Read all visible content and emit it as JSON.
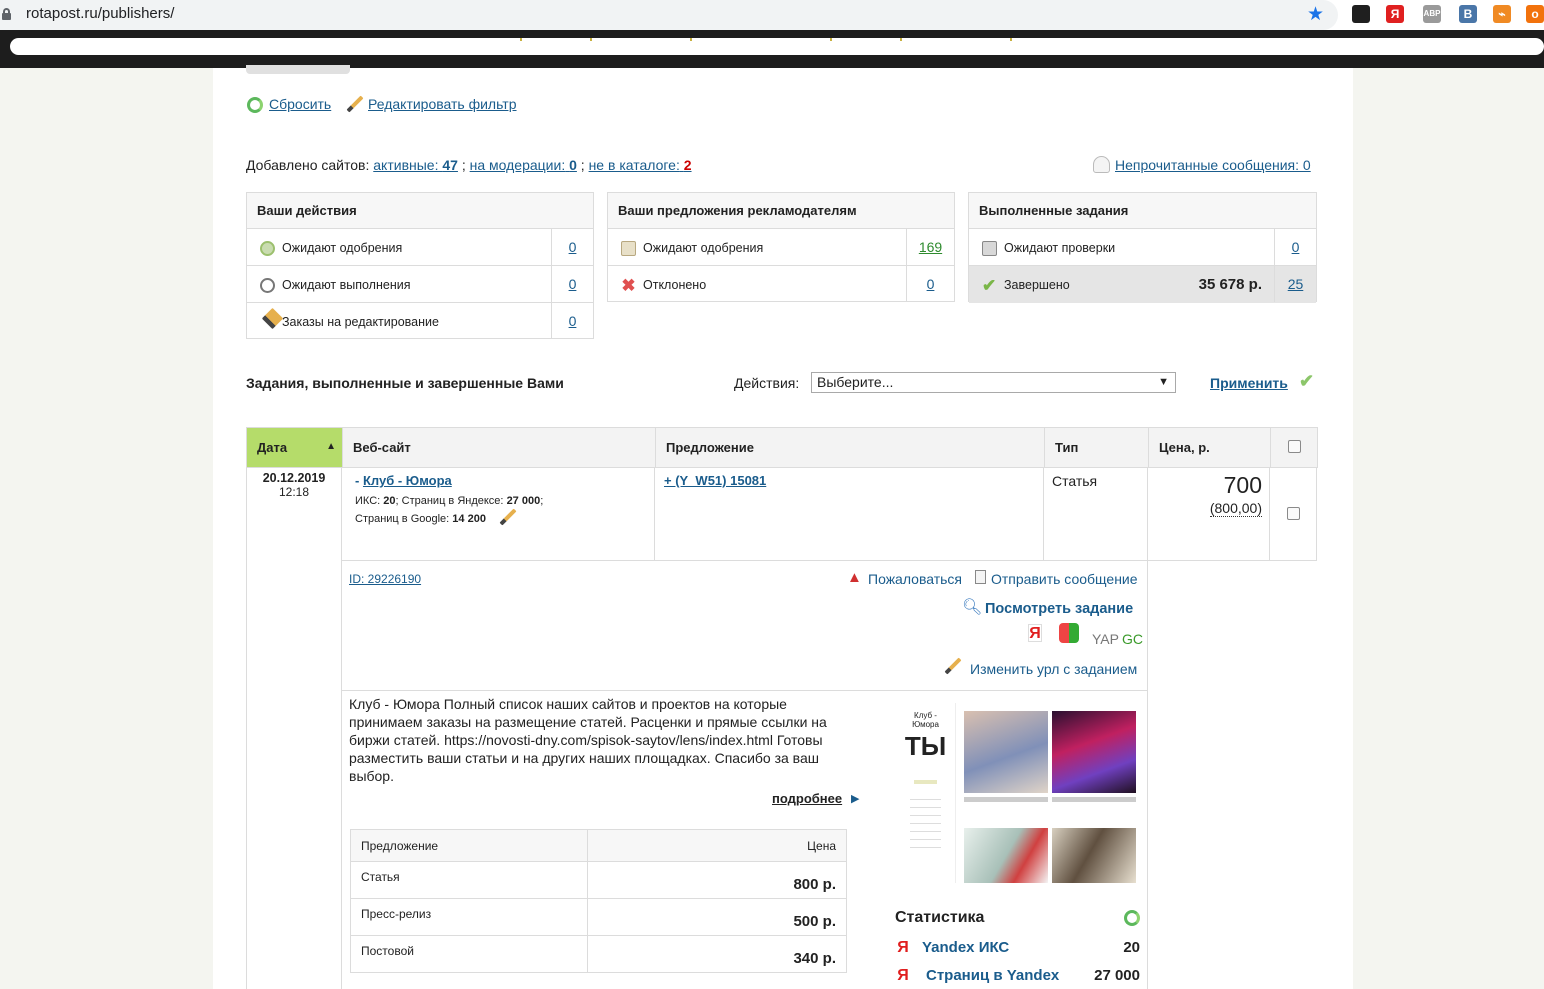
{
  "browser": {
    "url": "rotapost.ru/publishers/",
    "extensions": [
      {
        "name": "extension-1-icon",
        "glyph": "",
        "color": "#1f1f1f"
      },
      {
        "name": "yandex-extension-icon",
        "glyph": "Я",
        "color": "#e02020"
      },
      {
        "name": "adblock-extension-icon",
        "glyph": "ABP",
        "color": "#9a9a9a"
      },
      {
        "name": "vk-extension-icon",
        "glyph": "B",
        "color": "#4a76a8"
      },
      {
        "name": "rss-extension-icon",
        "glyph": "⌁",
        "color": "#f08a24"
      },
      {
        "name": "ok-extension-icon",
        "glyph": "о",
        "color": "#f2720c"
      }
    ]
  },
  "filter": {
    "reset_label": "Сбросить",
    "edit_label": "Редактировать фильтр"
  },
  "sites": {
    "prefix": "Добавлено сайтов:",
    "active_label": "активные:",
    "active_count": "47",
    "sep1": ";",
    "moderation_label": "на модерации:",
    "moderation_count": "0",
    "sep2": ";",
    "not_in_catalog_label": "не в каталоге:",
    "not_in_catalog_count": "2",
    "unread_messages": "Непрочитанные сообщения: 0"
  },
  "actions_box": {
    "title": "Ваши действия",
    "rows": [
      {
        "label": "Ожидают одобрения",
        "count": "0"
      },
      {
        "label": "Ожидают выполнения",
        "count": "0"
      },
      {
        "label": "Заказы на редактирование",
        "count": "0"
      }
    ]
  },
  "offers_box": {
    "title": "Ваши предложения рекламодателям",
    "rows": [
      {
        "label": "Ожидают одобрения",
        "count": "169"
      },
      {
        "label": "Отклонено",
        "count": "0"
      }
    ]
  },
  "done_box": {
    "title": "Выполненные задания",
    "rows": [
      {
        "label": "Ожидают проверки",
        "count": "0",
        "sum": ""
      },
      {
        "label": "Завершено",
        "count": "25",
        "sum": "35 678 р."
      }
    ]
  },
  "tasks_section": {
    "title": "Задания, выполненные и завершенные Вами",
    "actions_label": "Действия:",
    "select_value": "Выберите...",
    "apply_label": "Применить"
  },
  "table": {
    "headers": {
      "date": "Дата",
      "website": "Веб-сайт",
      "offer": "Предложение",
      "type": "Тип",
      "price": "Цена, р."
    },
    "row": {
      "date": "20.12.2019",
      "time": "12:18",
      "site_prefix": "-",
      "site_name": "Клуб - Юмора",
      "iks_label": "ИКС:",
      "iks_value": "20",
      "yandex_pages_label": "; Страниц в Яндексе:",
      "yandex_pages_value": "27 000",
      "yandex_pages_end": ";",
      "google_pages_label": "Страниц в Google:",
      "google_pages_value": "14 200",
      "offer": "+ (Y_W51) 15081",
      "type": "Статья",
      "price": "700",
      "price_old": "(800,00)"
    },
    "details": {
      "id": "ID: 29226190",
      "complain": "Пожаловаться",
      "send_message": "Отправить сообщение",
      "view_task": "Посмотреть задание",
      "yap": "YAP",
      "gc": "GC",
      "change_url": "Изменить урл с заданием"
    }
  },
  "site_info": {
    "description": "Клуб - Юмора Полный список наших сайтов и проектов на которые принимаем заказы на размещение статей. Расценки и прямые ссылки на биржи статей. https://novosti-dny.com/spisok-saytov/lens/index.html Готовы разместить ваши статьи и на других наших площадках. Спасибо за ваш выбор.",
    "more_label": "подробнее",
    "price_table": {
      "header_offer": "Предложение",
      "header_price": "Цена",
      "rows": [
        {
          "offer": "Статья",
          "price": "800 р."
        },
        {
          "offer": "Пресс-релиз",
          "price": "500 р."
        },
        {
          "offer": "Постовой",
          "price": "340 р."
        }
      ]
    },
    "screenshot": {
      "site_title_line1": "Клуб -",
      "site_title_line2": "Юмора",
      "logo_text": "ТЫ"
    },
    "stats": {
      "title": "Статистика",
      "rows": [
        {
          "label": "Yandex ИКС",
          "value": "20"
        },
        {
          "label": "Страниц в Yandex",
          "value": "27 000"
        }
      ]
    }
  },
  "colors": {
    "link": "#1a5c8c",
    "accent_green": "#b5dc6a",
    "red_count": "#cc0000"
  }
}
